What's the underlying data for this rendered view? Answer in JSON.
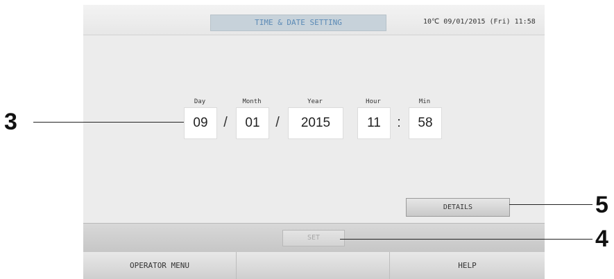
{
  "header": {
    "title": "TIME & DATE SETTING",
    "status": "10℃  09/01/2015 (Fri) 11:58"
  },
  "fields": {
    "day": {
      "label": "Day",
      "value": "09"
    },
    "month": {
      "label": "Month",
      "value": "01"
    },
    "year": {
      "label": "Year",
      "value": "2015"
    },
    "hour": {
      "label": "Hour",
      "value": "11"
    },
    "min": {
      "label": "Min",
      "value": "58"
    }
  },
  "separators": {
    "date": "/",
    "time": ":"
  },
  "buttons": {
    "details": "DETAILS",
    "set": "SET"
  },
  "footer": {
    "operator_menu": "OPERATOR MENU",
    "middle": "",
    "help": "HELP"
  },
  "callouts": {
    "c3": "3",
    "c4": "4",
    "c5": "5"
  }
}
